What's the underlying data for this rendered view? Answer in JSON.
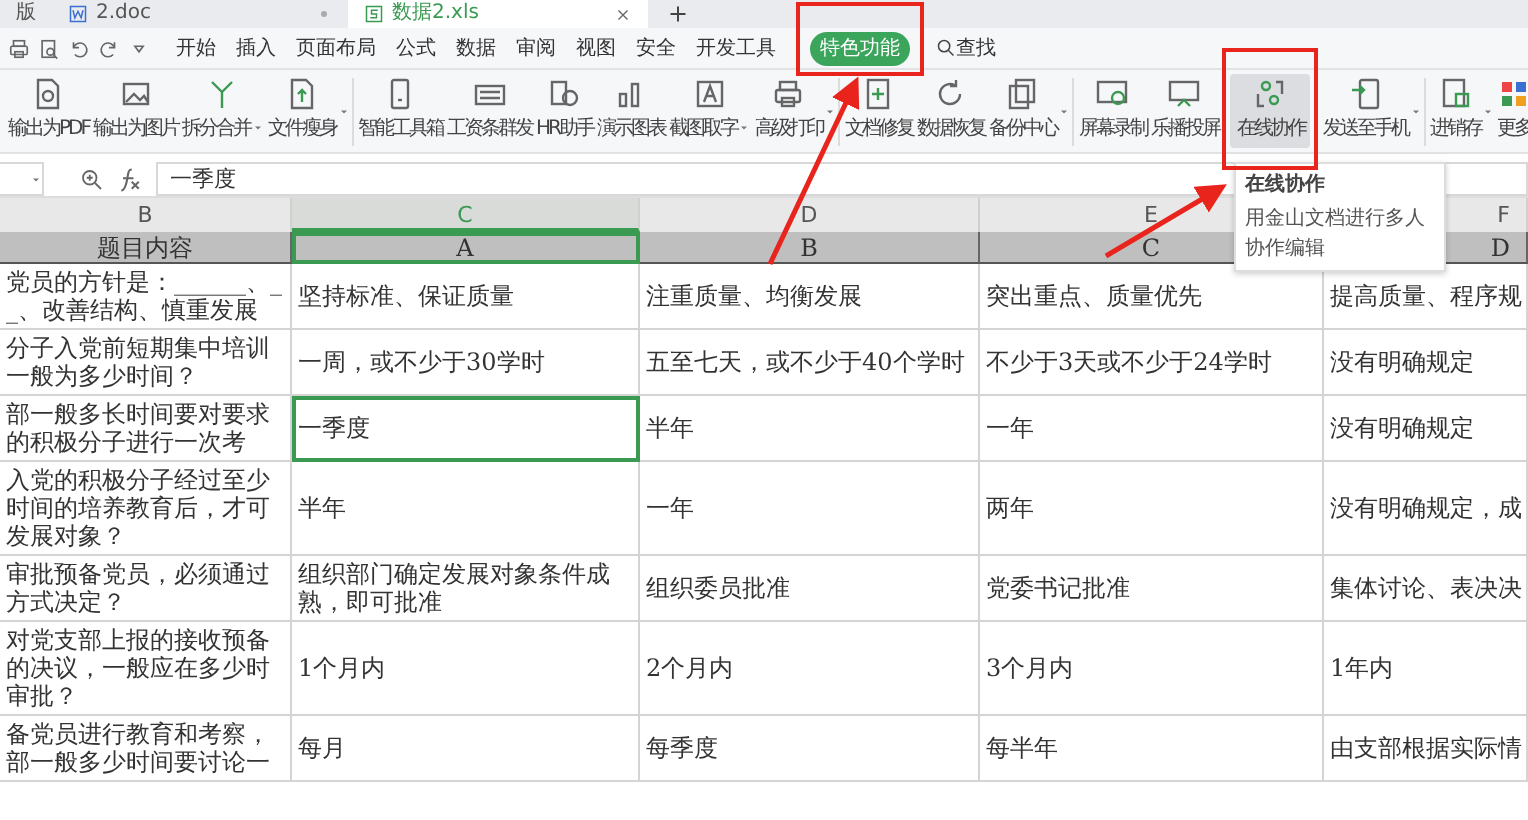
{
  "tabs": [
    {
      "label": "版",
      "kind": "plain",
      "selected": false
    },
    {
      "label": "2.doc",
      "kind": "doc",
      "selected": false
    },
    {
      "label": "数据2.xls",
      "kind": "sheet",
      "selected": true
    }
  ],
  "menu": [
    {
      "label": "开始",
      "selected": false
    },
    {
      "label": "插入",
      "selected": false
    },
    {
      "label": "页面布局",
      "selected": false
    },
    {
      "label": "公式",
      "selected": false
    },
    {
      "label": "数据",
      "selected": false
    },
    {
      "label": "审阅",
      "selected": false
    },
    {
      "label": "视图",
      "selected": false
    },
    {
      "label": "安全",
      "selected": false
    },
    {
      "label": "开发工具",
      "selected": false
    },
    {
      "label": "特色功能",
      "selected": true
    }
  ],
  "search": {
    "label": "查找"
  },
  "toolbar": {
    "groups": [
      [
        {
          "label": "输出为PDF",
          "kind": "button",
          "highlighted": false
        },
        {
          "label": "输出为图片",
          "kind": "button",
          "highlighted": false
        },
        {
          "label": "拆分合并",
          "kind": "dropdown",
          "highlighted": false
        },
        {
          "label": "文件瘦身",
          "kind": "split",
          "highlighted": false
        }
      ],
      [
        {
          "label": "智能工具箱",
          "kind": "button",
          "highlighted": false
        },
        {
          "label": "工资条群发",
          "kind": "button",
          "highlighted": false
        },
        {
          "label": "HR助手",
          "kind": "button",
          "highlighted": false
        },
        {
          "label": "演示图表",
          "kind": "button",
          "highlighted": false
        },
        {
          "label": "截图取字",
          "kind": "dropdown",
          "highlighted": false
        },
        {
          "label": "高级打印",
          "kind": "split",
          "highlighted": false
        }
      ],
      [
        {
          "label": "文档修复",
          "kind": "button",
          "highlighted": false
        },
        {
          "label": "数据恢复",
          "kind": "button",
          "highlighted": false
        },
        {
          "label": "备份中心",
          "kind": "split",
          "highlighted": false
        }
      ],
      [
        {
          "label": "屏幕录制",
          "kind": "button",
          "highlighted": false
        },
        {
          "label": "乐播投屏",
          "kind": "button",
          "highlighted": false
        },
        {
          "label": "在线协作",
          "kind": "button",
          "highlighted": true
        },
        {
          "label": "发送至手机",
          "kind": "split",
          "highlighted": false
        }
      ],
      [
        {
          "label": "进销存",
          "kind": "split",
          "highlighted": false
        },
        {
          "label": "更多",
          "kind": "button",
          "highlighted": false
        }
      ]
    ]
  },
  "tooltip": {
    "title": "在线协作",
    "text": "用金山文档进行多人协作编辑"
  },
  "formula_bar": {
    "value": "一季度"
  },
  "sheet": {
    "columns": [
      {
        "label": "B",
        "selected": false
      },
      {
        "label": "C",
        "selected": true
      },
      {
        "label": "D",
        "selected": false
      },
      {
        "label": "E",
        "selected": false
      },
      {
        "label": "F",
        "selected": false
      }
    ],
    "header_row": [
      "题目内容",
      "A",
      "B",
      "C",
      "D"
    ],
    "rows": [
      {
        "cells": [
          {
            "text": "党员的方针是：______、__、改善结构、慎重发展",
            "selected": false
          },
          {
            "text": "坚持标准、保证质量",
            "selected": false
          },
          {
            "text": "注重质量、均衡发展",
            "selected": false
          },
          {
            "text": "突出重点、质量优先",
            "selected": false
          },
          {
            "text": "提高质量、程序规",
            "selected": false
          }
        ]
      },
      {
        "cells": [
          {
            "text": "分子入党前短期集中培训一般为多少时间？",
            "selected": false
          },
          {
            "text": "一周，或不少于30学时",
            "selected": false
          },
          {
            "text": "五至七天，或不少于40个学时",
            "selected": false
          },
          {
            "text": "不少于3天或不少于24学时",
            "selected": false
          },
          {
            "text": "没有明确规定",
            "selected": false
          }
        ]
      },
      {
        "cells": [
          {
            "text": "部一般多长时间要对要求的积极分子进行一次考",
            "selected": false
          },
          {
            "text": "一季度",
            "selected": true
          },
          {
            "text": "半年",
            "selected": false
          },
          {
            "text": "一年",
            "selected": false
          },
          {
            "text": "没有明确规定",
            "selected": false
          }
        ]
      },
      {
        "cells": [
          {
            "text": "入党的积极分子经过至少时间的培养教育后，才可发展对象？",
            "selected": false
          },
          {
            "text": "半年",
            "selected": false
          },
          {
            "text": "一年",
            "selected": false
          },
          {
            "text": "两年",
            "selected": false
          },
          {
            "text": "没有明确规定，成",
            "selected": false
          }
        ]
      },
      {
        "cells": [
          {
            "text": "审批预备党员，必须通过方式决定？",
            "selected": false
          },
          {
            "text": "组织部门确定发展对象条件成熟，即可批准",
            "selected": false
          },
          {
            "text": "组织委员批准",
            "selected": false
          },
          {
            "text": "党委书记批准",
            "selected": false
          },
          {
            "text": "集体讨论、表决决",
            "selected": false
          }
        ]
      },
      {
        "cells": [
          {
            "text": "对党支部上报的接收预备的决议，一般应在多少时审批？",
            "selected": false
          },
          {
            "text": "1个月内",
            "selected": false
          },
          {
            "text": "2个月内",
            "selected": false
          },
          {
            "text": "3个月内",
            "selected": false
          },
          {
            "text": "1年内",
            "selected": false
          }
        ]
      },
      {
        "cells": [
          {
            "text": "备党员进行教育和考察，部一般多少时间要讨论一",
            "selected": false
          },
          {
            "text": "每月",
            "selected": false
          },
          {
            "text": "每季度",
            "selected": false
          },
          {
            "text": "每半年",
            "selected": false
          },
          {
            "text": "由支部根据实际情",
            "selected": false
          }
        ]
      }
    ]
  }
}
